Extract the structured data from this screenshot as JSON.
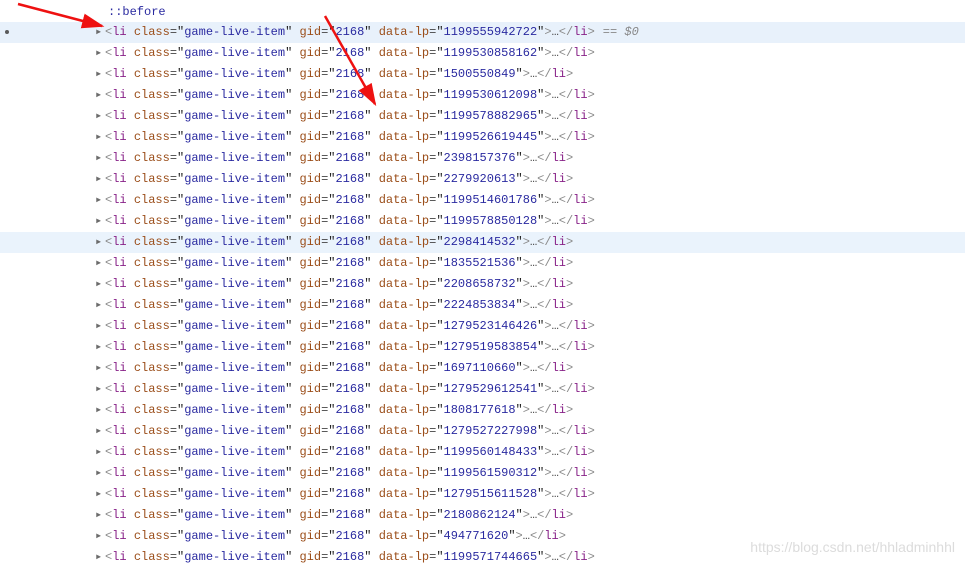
{
  "pseudo_before": "::before",
  "tag_name": "li",
  "attr_class_name": "class",
  "attr_gid_name": "gid",
  "attr_datalp_name": "data-lp",
  "gid_value": "2168",
  "class_value": "game-live-item",
  "ellipsis": "…",
  "close_tag_name": "li",
  "selected_marker": "== $0",
  "expand_glyph": "▸",
  "rows": [
    {
      "data_lp": "1199555942722",
      "highlight": true,
      "selected": true
    },
    {
      "data_lp": "1199530858162"
    },
    {
      "data_lp": "1500550849"
    },
    {
      "data_lp": "1199530612098"
    },
    {
      "data_lp": "1199578882965"
    },
    {
      "data_lp": "1199526619445"
    },
    {
      "data_lp": "2398157376"
    },
    {
      "data_lp": "2279920613"
    },
    {
      "data_lp": "1199514601786"
    },
    {
      "data_lp": "1199578850128"
    },
    {
      "data_lp": "2298414532",
      "hover": true
    },
    {
      "data_lp": "1835521536"
    },
    {
      "data_lp": "2208658732"
    },
    {
      "data_lp": "2224853834"
    },
    {
      "data_lp": "1279523146426"
    },
    {
      "data_lp": "1279519583854"
    },
    {
      "data_lp": "1697110660"
    },
    {
      "data_lp": "1279529612541"
    },
    {
      "data_lp": "1808177618"
    },
    {
      "data_lp": "1279527227998"
    },
    {
      "data_lp": "1199560148433"
    },
    {
      "data_lp": "1199561590312"
    },
    {
      "data_lp": "1279515611528"
    },
    {
      "data_lp": "2180862124"
    },
    {
      "data_lp": "494771620"
    },
    {
      "data_lp": "1199571744665"
    }
  ],
  "watermark": "https://blog.csdn.net/hhladminhhl"
}
